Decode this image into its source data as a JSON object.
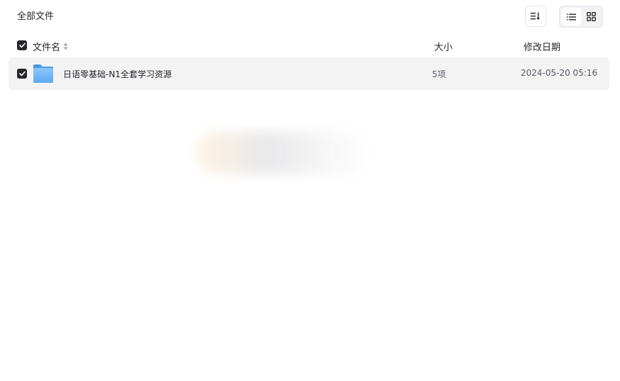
{
  "breadcrumb": {
    "label": "全部文件"
  },
  "toolbar": {
    "sort_icon": "sort-icon",
    "view_list_icon": "list-view-icon",
    "view_grid_icon": "grid-view-icon",
    "active_view": "list"
  },
  "table": {
    "select_all_checked": true,
    "columns": {
      "name": "文件名",
      "size": "大小",
      "date": "修改日期"
    },
    "rows": [
      {
        "checked": true,
        "type": "folder",
        "icon": "folder-icon",
        "name": "日语零基础-N1全套学习资源",
        "size": "5项",
        "date": "2024-05-20 05:16"
      }
    ]
  },
  "colors": {
    "row_selected_bg": "#f3f3f4",
    "checkbox_checked": "#25262b",
    "folder_blue": "#6fb3f5"
  }
}
